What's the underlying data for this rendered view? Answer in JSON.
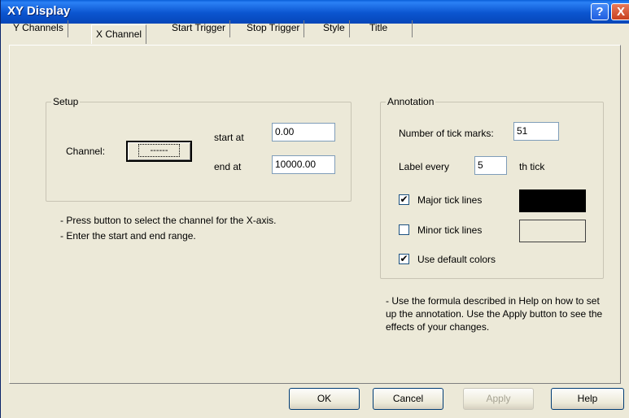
{
  "window": {
    "title": "XY Display",
    "help_glyph": "?",
    "close_glyph": "X"
  },
  "tabs": [
    {
      "label": "Y Channels",
      "active": false
    },
    {
      "label": "X Channel",
      "active": true
    },
    {
      "label": "Start Trigger",
      "active": false
    },
    {
      "label": "Stop Trigger",
      "active": false
    },
    {
      "label": "Style",
      "active": false
    },
    {
      "label": "Title",
      "active": false
    }
  ],
  "setup": {
    "legend": "Setup",
    "channel_label": "Channel:",
    "channel_button": "------",
    "start_label": "start at",
    "start_value": "0.00",
    "end_label": "end at",
    "end_value": "10000.00",
    "help_line1": "- Press button to select the channel for the X-axis.",
    "help_line2": "- Enter the start and end range."
  },
  "annotation": {
    "legend": "Annotation",
    "ticks_label": "Number of tick marks:",
    "ticks_value": "51",
    "label_every_prefix": "Label every",
    "label_every_value": "5",
    "label_every_suffix": "th tick",
    "major_label": "Major tick lines",
    "major_checked": true,
    "major_color": "#000000",
    "minor_label": "Minor tick lines",
    "minor_checked": false,
    "minor_color": "#ece9d8",
    "defaults_label": "Use default colors",
    "defaults_checked": true,
    "help_text": "- Use the formula described in Help on how to set up the annotation.  Use the Apply button to see the effects of your changes."
  },
  "buttons": {
    "ok": "OK",
    "cancel": "Cancel",
    "apply": "Apply",
    "help": "Help"
  },
  "colors": {
    "title_blue": "#0b55d0",
    "dialog_face": "#ece9d8"
  }
}
